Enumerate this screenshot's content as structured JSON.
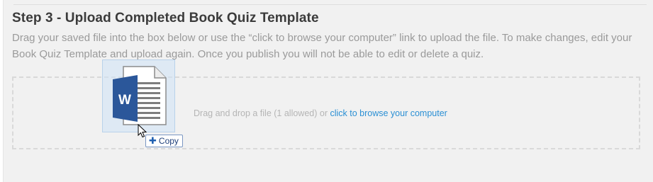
{
  "step": {
    "title": "Step 3 - Upload Completed Book Quiz Template",
    "instructions": "Drag your saved file into the box below or use the “click to browse your computer” link to upload the file. To make changes, edit your Book Quiz Template and upload again. Once you publish you will not be able to edit or delete a quiz."
  },
  "dropzone": {
    "prompt": "Drag and drop a file (1 allowed) or ",
    "browse_link": "click to browse your computer"
  },
  "drag": {
    "file_icon": "word-document-icon",
    "icon_letter": "W",
    "badge_label": "Copy",
    "badge_icon": "plus-icon"
  },
  "colors": {
    "link": "#2a8fd4",
    "word_blue": "#2b579a",
    "panel_bg": "#f1f1f1"
  }
}
